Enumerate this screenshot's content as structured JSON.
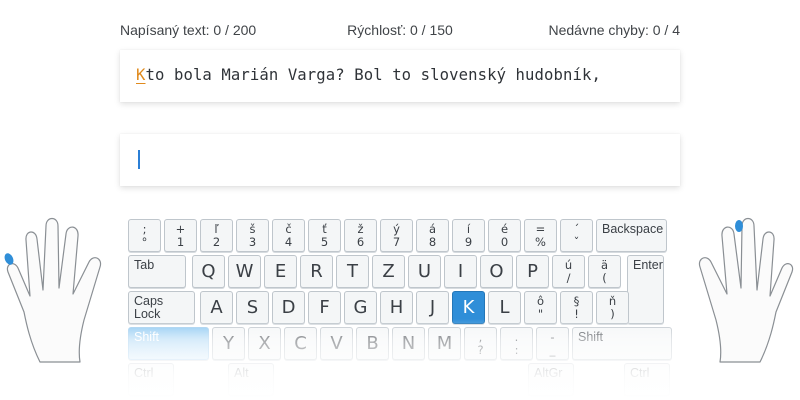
{
  "stats": {
    "typed": "Napísaný text: 0 / 200",
    "speed": "Rýchlosť: 0 / 150",
    "errors": "Nedávne chyby: 0 / 4"
  },
  "lesson": {
    "current_char": "K",
    "remaining_text": "to bola Marián Varga? Bol to slovenský hudobník,"
  },
  "input": {
    "value": ""
  },
  "keyboard": {
    "highlight_key": "K",
    "active_modifier": "Shift",
    "colors": {
      "highlight": "#2f8ed8",
      "caret": "#2b7fd6",
      "current_char": "#e08a1c"
    },
    "row0": [
      {
        "top": ";",
        "bottom": "°"
      },
      {
        "top": "+",
        "bottom": "1"
      },
      {
        "top": "ľ",
        "bottom": "2"
      },
      {
        "top": "š",
        "bottom": "3"
      },
      {
        "top": "č",
        "bottom": "4"
      },
      {
        "top": "ť",
        "bottom": "5"
      },
      {
        "top": "ž",
        "bottom": "6"
      },
      {
        "top": "ý",
        "bottom": "7"
      },
      {
        "top": "á",
        "bottom": "8"
      },
      {
        "top": "í",
        "bottom": "9"
      },
      {
        "top": "é",
        "bottom": "0"
      },
      {
        "top": "=",
        "bottom": "%"
      },
      {
        "top": "´",
        "bottom": "ˇ"
      }
    ],
    "backspace": "Backspace",
    "tab": "Tab",
    "row1_letters": [
      "Q",
      "W",
      "E",
      "R",
      "T",
      "Z",
      "U",
      "I",
      "O",
      "P"
    ],
    "row1_dual": [
      {
        "top": "ú",
        "bottom": "/"
      },
      {
        "top": "ä",
        "bottom": "("
      }
    ],
    "enter": "Enter",
    "caps_lock": [
      "Caps",
      "Lock"
    ],
    "row2_letters": [
      "A",
      "S",
      "D",
      "F",
      "G",
      "H",
      "J",
      "K",
      "L"
    ],
    "row2_dual": [
      {
        "top": "ô",
        "bottom": "\""
      },
      {
        "top": "§",
        "bottom": "!"
      },
      {
        "top": "ň",
        "bottom": ")"
      }
    ],
    "shift_left": "Shift",
    "row3_letters": [
      "Y",
      "X",
      "C",
      "V",
      "B",
      "N",
      "M"
    ],
    "row3_dual": [
      {
        "top": ",",
        "bottom": "?"
      },
      {
        "top": ".",
        "bottom": ":"
      },
      {
        "top": "-",
        "bottom": "_"
      }
    ],
    "shift_right": "Shift",
    "row4": [
      "Ctrl",
      "Alt",
      "AltGr",
      "Ctrl"
    ]
  },
  "hands": {
    "left_finger": "little",
    "right_finger": "middle",
    "finger_color": "#2f8ed8"
  }
}
